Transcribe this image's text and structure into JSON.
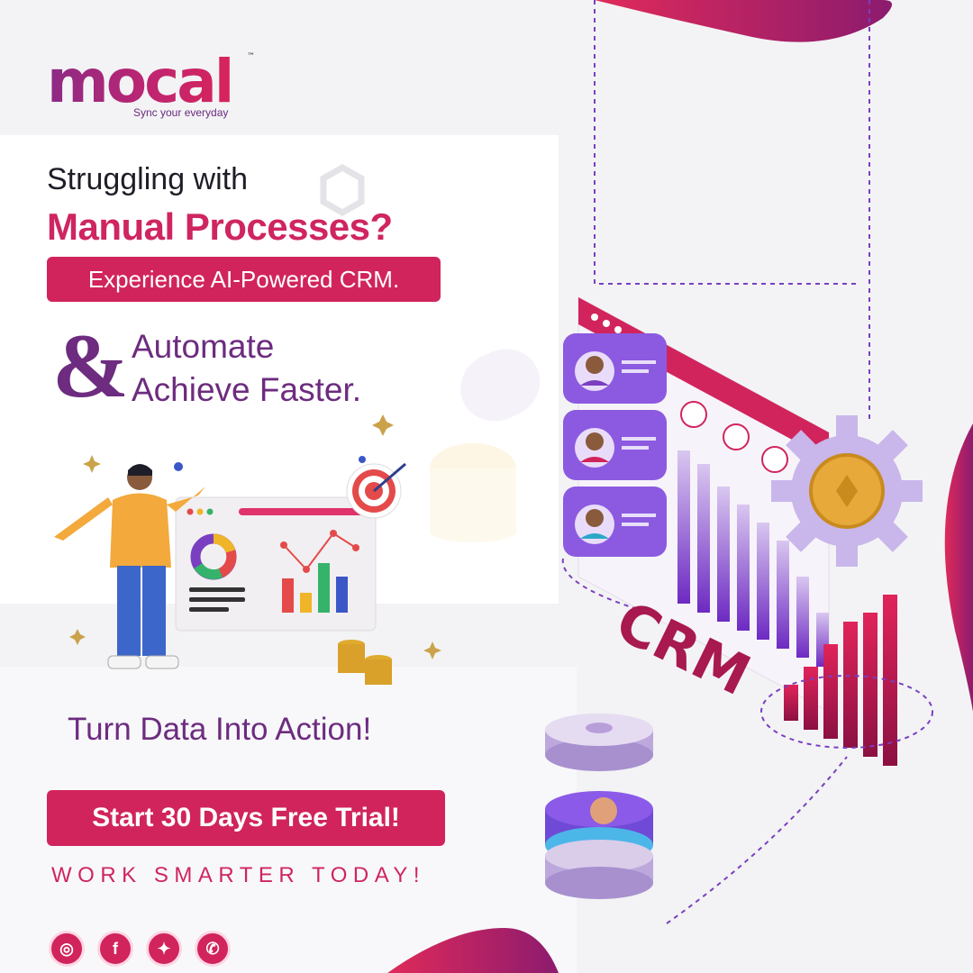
{
  "brand": {
    "name": "mocal",
    "trademark": "™",
    "tagline": "Sync your everyday"
  },
  "headline": {
    "line1": "Struggling with",
    "line2": "Manual Processes?",
    "cta_crm": "Experience AI-Powered CRM.",
    "ampersand": "&",
    "line3": "Automate",
    "line4": "Achieve Faster."
  },
  "tagline_action": "Turn Data Into Action!",
  "trial_button": "Start 30 Days Free Trial!",
  "work_smarter": "WORK SMARTER TODAY!",
  "illustration": {
    "crm_label": "CRM"
  },
  "social": [
    {
      "name": "instagram-icon",
      "glyph": "◎"
    },
    {
      "name": "facebook-icon",
      "glyph": "f"
    },
    {
      "name": "twitter-icon",
      "glyph": "✦"
    },
    {
      "name": "whatsapp-icon",
      "glyph": "✆"
    }
  ],
  "colors": {
    "primary": "#d1245c",
    "purple": "#6d2c7f",
    "dark": "#1e1e28"
  }
}
